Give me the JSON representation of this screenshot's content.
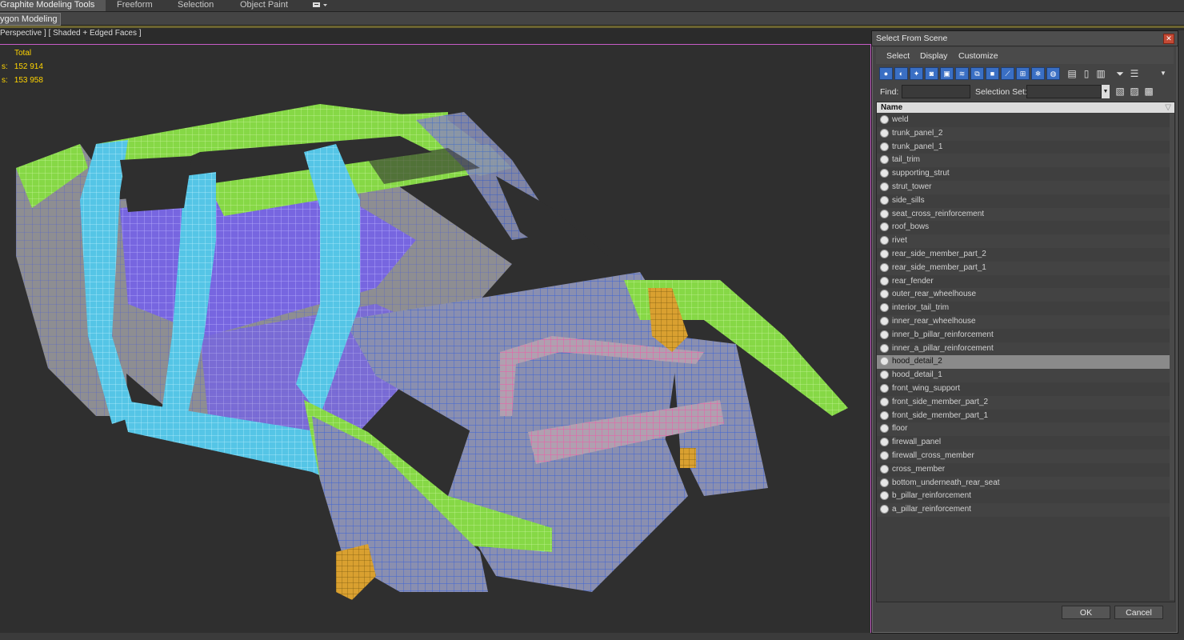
{
  "ribbon": {
    "tabs": [
      "Graphite Modeling Tools",
      "Freeform",
      "Selection",
      "Object Paint"
    ],
    "sub_tab": "ygon Modeling"
  },
  "viewport": {
    "label": "Perspective ] [ Shaded + Edged Faces ]",
    "stats": {
      "header": "Total",
      "row1_prefix": "s:",
      "row1_value": "152 914",
      "row2_prefix": "s:",
      "row2_value": "153 958"
    },
    "colors": {
      "border": "#c75bc7",
      "stats_text": "#ffd400",
      "mesh_green": "#8ee04a",
      "mesh_cyan": "#5fd3f0",
      "mesh_blue": "#3c63d6",
      "mesh_violet": "#7b68f0",
      "mesh_pink": "#f05aa8",
      "mesh_orange": "#e0a52a"
    }
  },
  "dialog": {
    "title": "Select From Scene",
    "close_icon": "close-icon",
    "menu": [
      "Select",
      "Display",
      "Customize"
    ],
    "find_label": "Find:",
    "find_value": "",
    "selection_set_label": "Selection Set:",
    "selection_set_value": "",
    "column_header": "Name",
    "items": [
      "weld",
      "trunk_panel_2",
      "trunk_panel_1",
      "tail_trim",
      "supporting_strut",
      "strut_tower",
      "side_sills",
      "seat_cross_reinforcement",
      "roof_bows",
      "rivet",
      "rear_side_member_part_2",
      "rear_side_member_part_1",
      "rear_fender",
      "outer_rear_wheelhouse",
      "interior_tail_trim",
      "inner_rear_wheelhouse",
      "inner_b_pillar_reinforcement",
      "inner_a_pillar_reinforcement",
      "hood_detail_2",
      "hood_detail_1",
      "front_wing_support",
      "front_side_member_part_2",
      "front_side_member_part_1",
      "floor",
      "firewall_panel",
      "firewall_cross_member",
      "cross_member",
      "bottom_underneath_rear_seat",
      "b_pillar_reinforcement",
      "a_pillar_reinforcement"
    ],
    "selected_item": "hood_detail_2",
    "ok_label": "OK",
    "cancel_label": "Cancel",
    "accent_color": "#3a6fc4"
  }
}
